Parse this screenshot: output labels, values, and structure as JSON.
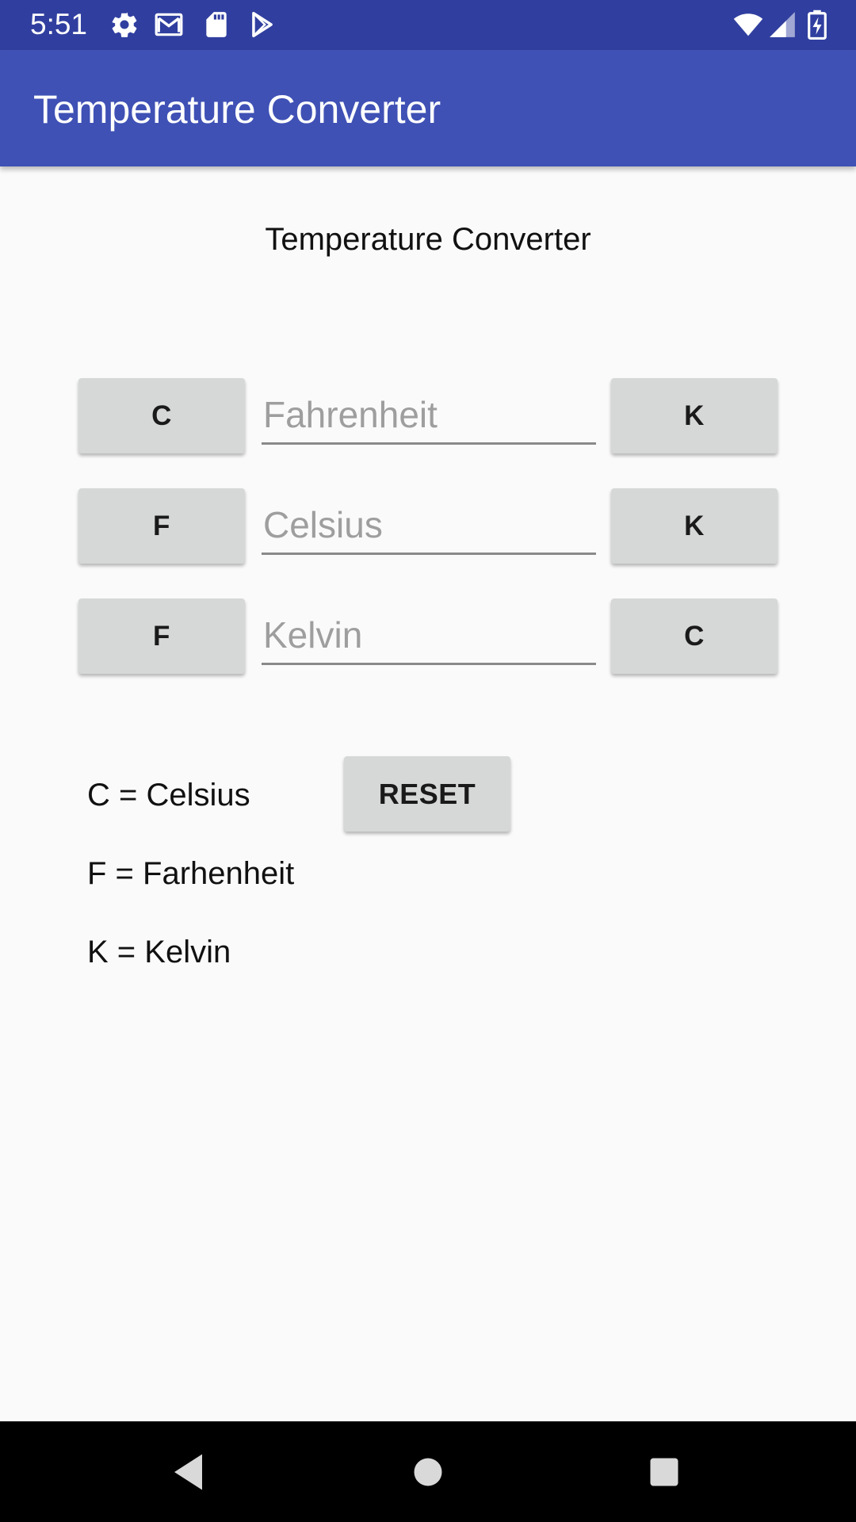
{
  "status_bar": {
    "time": "5:51",
    "icons": [
      "settings-icon",
      "gmail-icon",
      "sd-card-icon",
      "play-store-icon",
      "wifi-icon",
      "signal-icon",
      "battery-charging-icon"
    ]
  },
  "app_bar": {
    "title": "Temperature Converter",
    "color": "#3f51b5",
    "status_color": "#303f9f"
  },
  "main": {
    "heading": "Temperature Converter",
    "rows": [
      {
        "left_button": "C",
        "input_placeholder": "Fahrenheit",
        "input_value": "",
        "right_button": "K"
      },
      {
        "left_button": "F",
        "input_placeholder": "Celsius",
        "input_value": "",
        "right_button": "K"
      },
      {
        "left_button": "F",
        "input_placeholder": "Kelvin",
        "input_value": "",
        "right_button": "C"
      }
    ],
    "reset_label": "RESET",
    "legend": [
      "C = Celsius",
      "F = Farhenheit",
      "K = Kelvin"
    ]
  },
  "nav_bar": {
    "icons": [
      "back-icon",
      "home-icon",
      "recents-icon"
    ]
  }
}
